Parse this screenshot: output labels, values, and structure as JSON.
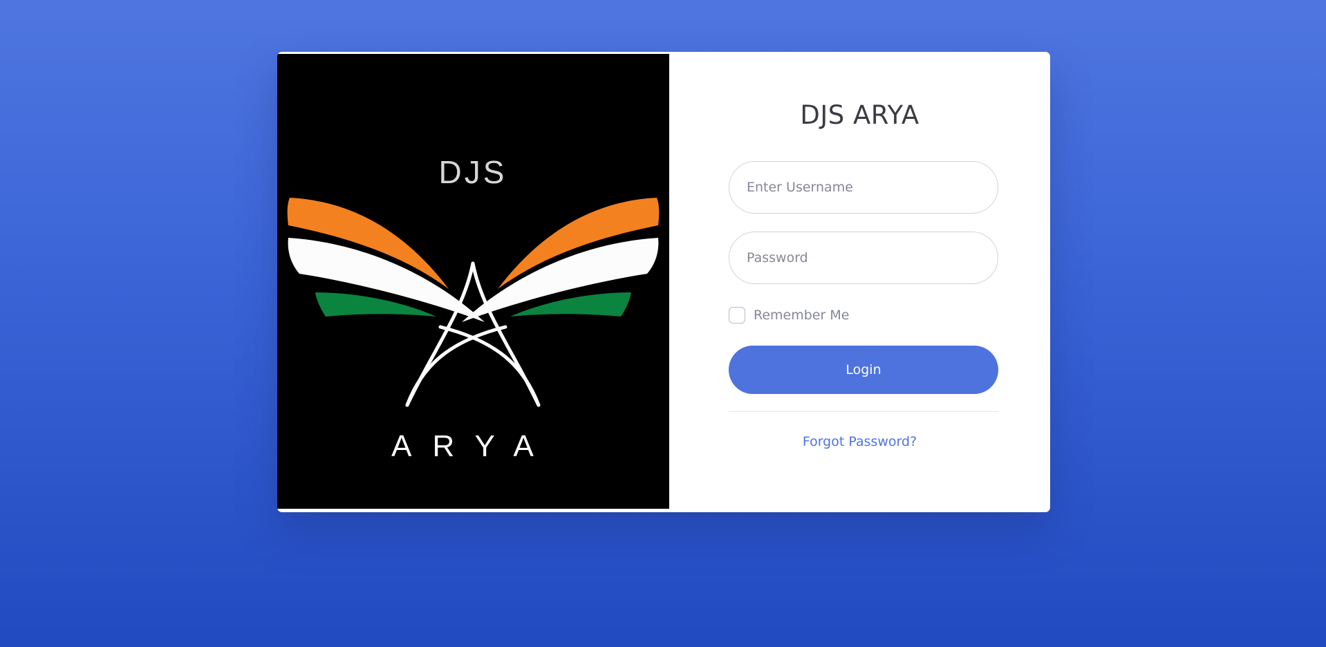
{
  "logo": {
    "top_text": "DJS",
    "bottom_text": "ARYA",
    "colors": {
      "background": "#000000",
      "saffron": "#f48120",
      "white": "#fcfcfc",
      "green": "#0b8440"
    }
  },
  "form": {
    "title": "DJS ARYA",
    "username_placeholder": "Enter Username",
    "password_placeholder": "Password",
    "remember_label": "Remember Me",
    "remember_checked": false,
    "login_label": "Login",
    "forgot_label": "Forgot Password?"
  },
  "theme": {
    "accent": "#4e73df",
    "background_top": "#4f76e0",
    "background_bottom": "#224ac0"
  }
}
